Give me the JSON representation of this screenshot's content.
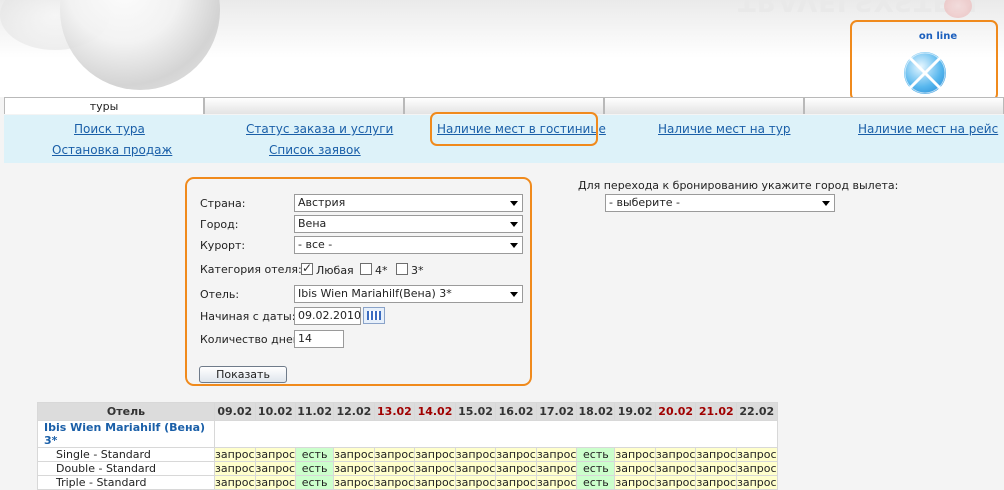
{
  "brand": {
    "logo_text": "TRAVELSYSTEM",
    "online_label": "on line"
  },
  "tabs": [
    {
      "label": "туры"
    },
    {
      "label": ""
    },
    {
      "label": ""
    },
    {
      "label": ""
    },
    {
      "label": ""
    }
  ],
  "subnav": {
    "tour_search": "Поиск тура",
    "order_status": "Статус заказа и услуги",
    "hotel_availability": "Наличие мест в гостинице",
    "tour_availability": "Наличие мест на тур",
    "flight_availability": "Наличие мест на рейс",
    "stop_sales": "Остановка продаж",
    "order_list": "Список заявок"
  },
  "form": {
    "country_label": "Страна:",
    "country_value": "Австрия",
    "city_label": "Город:",
    "city_value": "Вена",
    "resort_label": "Курорт:",
    "resort_value": "- все -",
    "category_label": "Категория отеля:",
    "category_any": "Любая",
    "category_4": "4*",
    "category_3": "3*",
    "hotel_label": "Отель:",
    "hotel_value": "Ibis Wien Mariahilf(Вена) 3*",
    "date_label": "Начиная с даты:",
    "date_value": "09.02.2010",
    "days_label": "Количество дней:",
    "days_value": "14",
    "show_button": "Показать"
  },
  "departure": {
    "label": "Для перехода к бронированию укажите город вылета:",
    "value": "- выберите -"
  },
  "availability": {
    "hotel_col": "Отель",
    "dates": [
      "09.02",
      "10.02",
      "11.02",
      "12.02",
      "13.02",
      "14.02",
      "15.02",
      "16.02",
      "17.02",
      "18.02",
      "19.02",
      "20.02",
      "21.02",
      "22.02"
    ],
    "weekend_dates": [
      "13.02",
      "14.02",
      "20.02",
      "21.02"
    ],
    "hotel_name": "Ibis Wien Mariahilf (Вена) 3*",
    "rooms": [
      {
        "name": "Single - Standard",
        "cells": [
          "запрос",
          "запрос",
          "есть",
          "запрос",
          "запрос",
          "запрос",
          "запрос",
          "запрос",
          "запрос",
          "есть",
          "запрос",
          "запрос",
          "запрос",
          "запрос"
        ]
      },
      {
        "name": "Double - Standard",
        "cells": [
          "запрос",
          "запрос",
          "есть",
          "запрос",
          "запрос",
          "запрос",
          "запрос",
          "запрос",
          "запрос",
          "есть",
          "запрос",
          "запрос",
          "запрос",
          "запрос"
        ]
      },
      {
        "name": "Triple - Standard",
        "cells": [
          "запрос",
          "запрос",
          "есть",
          "запрос",
          "запрос",
          "запрос",
          "запрос",
          "запрос",
          "запрос",
          "есть",
          "запрос",
          "запрос",
          "запрос",
          "запрос"
        ]
      }
    ]
  },
  "colors": {
    "accent_outline": "#f08a1c",
    "link": "#1a5fa8",
    "available_bg": "#ccffcc",
    "request_bg": "#ffffcc",
    "weekend_text": "#a00000"
  }
}
